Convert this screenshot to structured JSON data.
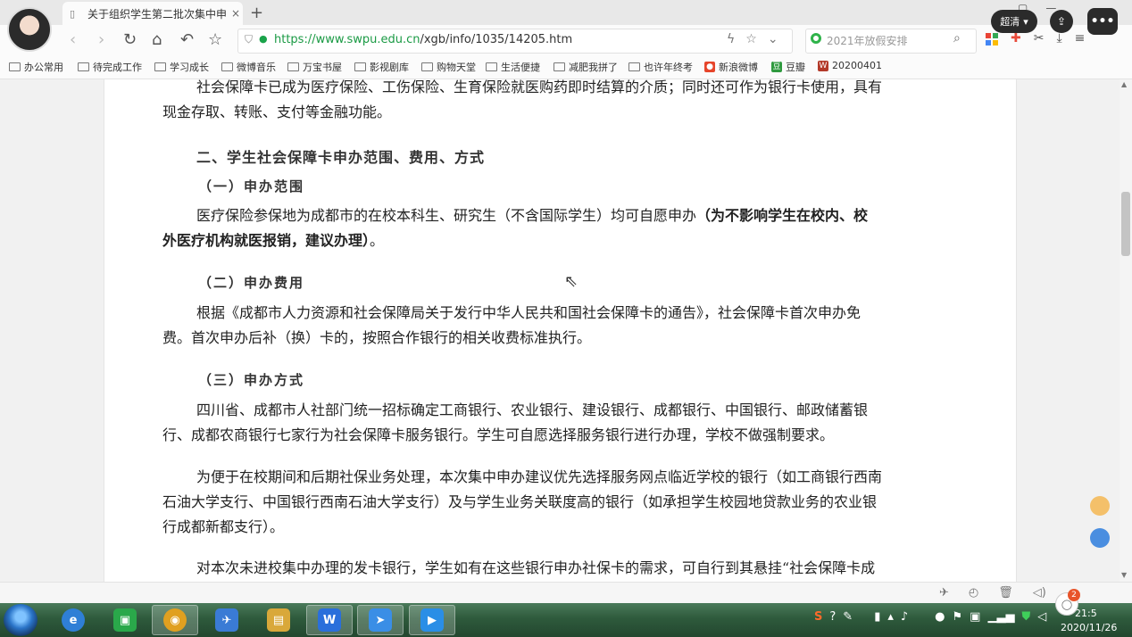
{
  "browser": {
    "tab_title": "关于组织学生第二批次集中申",
    "tab_close": "×",
    "new_tab": "+",
    "window_controls": [
      "▢",
      "—"
    ],
    "sharp_label": "超清",
    "url_prefix": "https://",
    "url_domain": "www.swpu.edu.cn",
    "url_path": "/xgb/info/1035/14205.htm",
    "search_text": "2021年放假安排"
  },
  "bookmarks": [
    {
      "label": "办公常用",
      "icon": "folder-icon"
    },
    {
      "label": "待完成工作",
      "icon": "folder-icon"
    },
    {
      "label": "学习成长",
      "icon": "folder-icon"
    },
    {
      "label": "微博音乐",
      "icon": "folder-icon"
    },
    {
      "label": "万宝书屋",
      "icon": "folder-icon"
    },
    {
      "label": "影视剧库",
      "icon": "folder-icon"
    },
    {
      "label": "购物天堂",
      "icon": "folder-icon"
    },
    {
      "label": "生活便捷",
      "icon": "folder-icon"
    },
    {
      "label": "减肥我拼了",
      "icon": "folder-icon"
    },
    {
      "label": "也许年终考",
      "icon": "folder-icon"
    },
    {
      "label": "新浪微博",
      "icon": "weibo-icon"
    },
    {
      "label": "豆瓣",
      "icon": "douban-icon"
    },
    {
      "label": "20200401",
      "icon": "bookmark-icon"
    }
  ],
  "content": {
    "p1_line1": "社会保障卡已成为医疗保险、工伤保险、生育保险就医购药即时结算的介质；同时还可作为银行卡使用，具有",
    "p1_line2": "现金存取、转账、支付等金融功能。",
    "heading2": "二、学生社会保障卡申办范围、费用、方式",
    "sub1": "（一）申办范围",
    "p2_line1_plain": "医疗保险参保地为成都市的在校本科生、研究生（不含国际学生）均可自愿申办",
    "p2_line1_bold": "（为不影响学生在校内、校",
    "p2_line2_bold": "外医疗机构就医报销，建议办理）",
    "p2_line2_end": "。",
    "sub2": "（二）申办费用",
    "p3_line1": "根据《成都市人力资源和社会保障局关于发行中华人民共和国社会保障卡的通告》，社会保障卡首次申办免",
    "p3_line2": "费。首次申办后补（换）卡的，按照合作银行的相关收费标准执行。",
    "sub3": "（三）申办方式",
    "p4_line1": "四川省、成都市人社部门统一招标确定工商银行、农业银行、建设银行、成都银行、中国银行、邮政储蓄银",
    "p4_line2": "行、成都农商银行七家行为社会保障卡服务银行。学生可自愿选择服务银行进行办理，学校不做强制要求。",
    "p5_line1": "为便于在校期间和后期社保业务处理，本次集中申办建议优先选择服务网点临近学校的银行（如工商银行西南",
    "p5_line2": "石油大学支行、中国银行西南石油大学支行）及与学生业务关联度高的银行（如承担学生校园地贷款业务的农业银",
    "p5_line3": "行成都新都支行）。",
    "p6_line1": "对本次未进校集中办理的发卡银行，学生如有在这些银行申办社保卡的需求，可自行到其悬挂“社会保障卡成"
  },
  "status": {
    "badge_count": "2"
  },
  "taskbar": {
    "apps": [
      {
        "name": "ie-icon",
        "glyph": "e",
        "color": "#2f7fd6"
      },
      {
        "name": "wechat-icon",
        "glyph": "▣",
        "color": "#2aa84a"
      },
      {
        "name": "chrome-icon",
        "glyph": "◉",
        "color": "#e0a020"
      },
      {
        "name": "feishu-icon",
        "glyph": "✈",
        "color": "#3a7bd5"
      },
      {
        "name": "explorer-icon",
        "glyph": "▤",
        "color": "#d9a83a"
      },
      {
        "name": "wps-icon",
        "glyph": "W",
        "color": "#2a6fdb"
      },
      {
        "name": "dingtalk-icon",
        "glyph": "➤",
        "color": "#3a8ee6"
      },
      {
        "name": "video-icon",
        "glyph": "▶",
        "color": "#2a8ee6"
      }
    ],
    "clock_time": "21:5",
    "clock_date": "2020/11/26"
  },
  "colors": {
    "url_domain": "#1a9a44",
    "taskbar": "#2e5a3c"
  }
}
